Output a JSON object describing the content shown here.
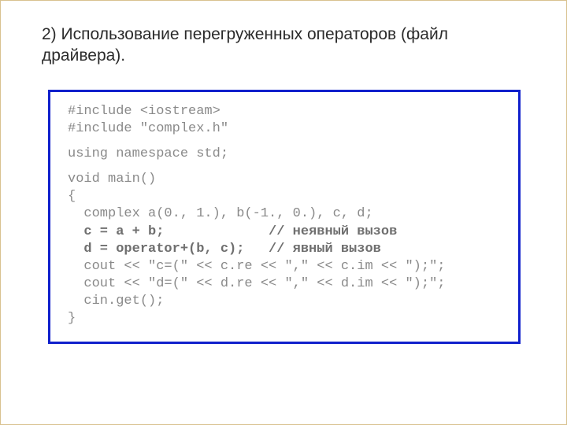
{
  "title": "2) Использование перегруженных операторов (файл драйвера).",
  "code": {
    "l01": "#include <iostream>",
    "l02": "#include \"complex.h\"",
    "l03": "using namespace std;",
    "l04": "void main()",
    "l05": "{",
    "l06": "  complex a(0., 1.), b(-1., 0.), c, d;",
    "l07": "  c = a + b;             // неявный вызов",
    "l08": "  d = operator+(b, c);   // явный вызов",
    "l09": "  cout << \"c=(\" << c.re << \",\" << c.im << \");\";",
    "l10": "  cout << \"d=(\" << d.re << \",\" << d.im << \");\";",
    "l11": "  cin.get();",
    "l12": "}"
  }
}
